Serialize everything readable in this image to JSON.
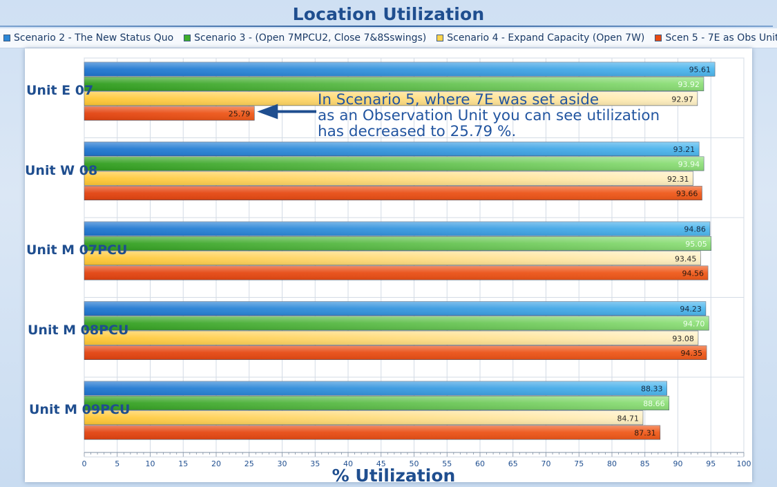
{
  "title": "Location Utilization",
  "legend": [
    {
      "label": "Scenario 2 - The New Status Quo",
      "color": "#2a86d6"
    },
    {
      "label": "Scenario 3 - (Open 7MPCU2, Close 7&8Sswings)",
      "color": "#3fae2a"
    },
    {
      "label": "Scenario 4 - Expand Capacity (Open 7W)",
      "color": "#ffd34a"
    },
    {
      "label": "Scen 5 - 7E as Obs Unit",
      "color": "#e84a12"
    }
  ],
  "annotation": {
    "line1": "In Scenario 5, where 7E was set aside",
    "line2": "as an Observation Unit you can see utilization",
    "line3": "has decreased to 25.79 %."
  },
  "chart_data": {
    "type": "bar",
    "orientation": "horizontal",
    "title": "Location Utilization",
    "xlabel": "% Utilization",
    "ylabel": "",
    "xlim": [
      0,
      100
    ],
    "xticks": [
      "0",
      "5",
      "10",
      "15",
      "20",
      "25",
      "30",
      "35",
      "40",
      "45",
      "50",
      "55",
      "60",
      "65",
      "70",
      "75",
      "80",
      "85",
      "90",
      "95",
      "100"
    ],
    "grid": true,
    "legend_position": "top",
    "categories": [
      "Unit E 07",
      "Unit W 08",
      "Unit M 07PCU",
      "Unit M 08PCU",
      "Unit M 09PCU"
    ],
    "series": [
      {
        "name": "Scenario 2 - The New Status Quo",
        "values": [
          95.61,
          93.21,
          94.86,
          94.23,
          88.33
        ]
      },
      {
        "name": "Scenario 3 - (Open 7MPCU2, Close 7&8Sswings)",
        "values": [
          93.92,
          93.94,
          95.05,
          94.7,
          88.66
        ]
      },
      {
        "name": "Scenario 4 - Expand Capacity (Open 7W)",
        "values": [
          92.97,
          92.31,
          93.45,
          93.08,
          84.71
        ]
      },
      {
        "name": "Scen 5 - 7E as Obs Unit",
        "values": [
          25.79,
          93.66,
          94.56,
          94.35,
          87.31
        ]
      }
    ],
    "value_labels": [
      [
        "95.61",
        "93.92",
        "92.97",
        "25.79"
      ],
      [
        "93.21",
        "93.94",
        "92.31",
        "93.66"
      ],
      [
        "94.86",
        "95.05",
        "93.45",
        "94.56"
      ],
      [
        "94.23",
        "94.70",
        "93.08",
        "94.35"
      ],
      [
        "88.33",
        "88.66",
        "84.71",
        "87.31"
      ]
    ]
  }
}
